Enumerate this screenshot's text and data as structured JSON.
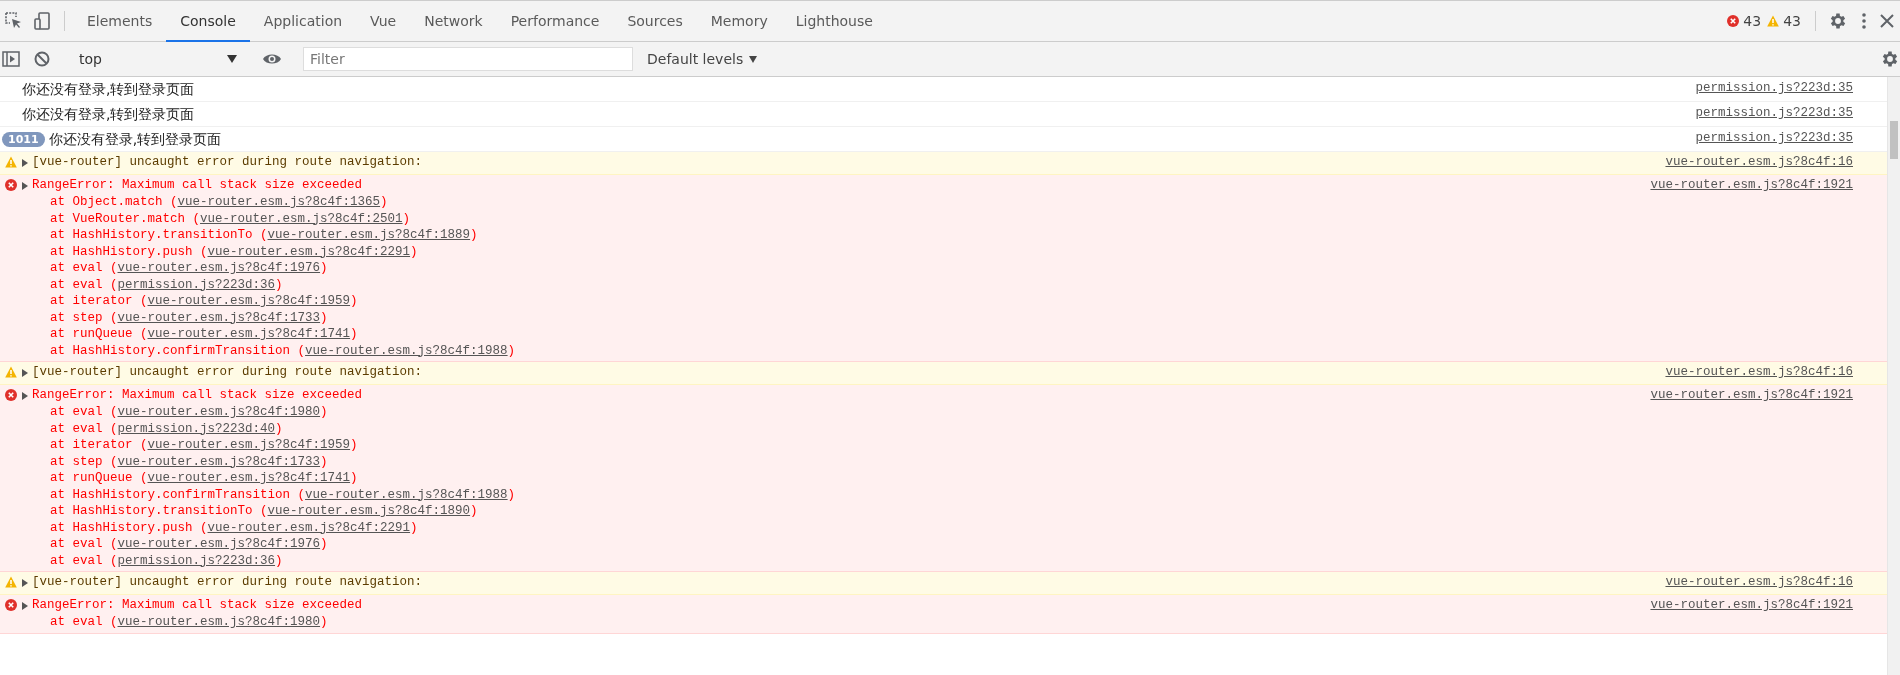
{
  "tabs": [
    {
      "label": "Elements",
      "selected": false
    },
    {
      "label": "Console",
      "selected": true
    },
    {
      "label": "Application",
      "selected": false
    },
    {
      "label": "Vue",
      "selected": false
    },
    {
      "label": "Network",
      "selected": false
    },
    {
      "label": "Performance",
      "selected": false
    },
    {
      "label": "Sources",
      "selected": false
    },
    {
      "label": "Memory",
      "selected": false
    },
    {
      "label": "Lighthouse",
      "selected": false
    }
  ],
  "counts": {
    "errors": "43",
    "warnings": "43"
  },
  "console_toolbar": {
    "context": "top",
    "filter": {
      "placeholder": "Filter"
    },
    "levels": "Default levels"
  },
  "messages": [
    {
      "kind": "log",
      "text": "你还没有登录,转到登录页面",
      "source": "permission.js?223d:35"
    },
    {
      "kind": "log",
      "text": "你还没有登录,转到登录页面",
      "source": "permission.js?223d:35"
    },
    {
      "kind": "log",
      "count": "1011",
      "text": "你还没有登录,转到登录页面",
      "source": "permission.js?223d:35"
    },
    {
      "kind": "warning",
      "text": "[vue-router] uncaught error during route navigation:",
      "source": "vue-router.esm.js?8c4f:16"
    },
    {
      "kind": "error",
      "text": "RangeError: Maximum call stack size exceeded",
      "source": "vue-router.esm.js?8c4f:1921",
      "frames": [
        {
          "before": "at Object.match (",
          "link": "vue-router.esm.js?8c4f:1365",
          "after": ")"
        },
        {
          "before": "at VueRouter.match (",
          "link": "vue-router.esm.js?8c4f:2501",
          "after": ")"
        },
        {
          "before": "at HashHistory.transitionTo (",
          "link": "vue-router.esm.js?8c4f:1889",
          "after": ")"
        },
        {
          "before": "at HashHistory.push (",
          "link": "vue-router.esm.js?8c4f:2291",
          "after": ")"
        },
        {
          "before": "at eval (",
          "link": "vue-router.esm.js?8c4f:1976",
          "after": ")"
        },
        {
          "before": "at eval (",
          "link": "permission.js?223d:36",
          "after": ")"
        },
        {
          "before": "at iterator (",
          "link": "vue-router.esm.js?8c4f:1959",
          "after": ")"
        },
        {
          "before": "at step (",
          "link": "vue-router.esm.js?8c4f:1733",
          "after": ")"
        },
        {
          "before": "at runQueue (",
          "link": "vue-router.esm.js?8c4f:1741",
          "after": ")"
        },
        {
          "before": "at HashHistory.confirmTransition (",
          "link": "vue-router.esm.js?8c4f:1988",
          "after": ")"
        }
      ]
    },
    {
      "kind": "warning",
      "text": "[vue-router] uncaught error during route navigation:",
      "source": "vue-router.esm.js?8c4f:16"
    },
    {
      "kind": "error",
      "text": "RangeError: Maximum call stack size exceeded",
      "source": "vue-router.esm.js?8c4f:1921",
      "frames": [
        {
          "before": "at eval (",
          "link": "vue-router.esm.js?8c4f:1980",
          "after": ")"
        },
        {
          "before": "at eval (",
          "link": "permission.js?223d:40",
          "after": ")"
        },
        {
          "before": "at iterator (",
          "link": "vue-router.esm.js?8c4f:1959",
          "after": ")"
        },
        {
          "before": "at step (",
          "link": "vue-router.esm.js?8c4f:1733",
          "after": ")"
        },
        {
          "before": "at runQueue (",
          "link": "vue-router.esm.js?8c4f:1741",
          "after": ")"
        },
        {
          "before": "at HashHistory.confirmTransition (",
          "link": "vue-router.esm.js?8c4f:1988",
          "after": ")"
        },
        {
          "before": "at HashHistory.transitionTo (",
          "link": "vue-router.esm.js?8c4f:1890",
          "after": ")"
        },
        {
          "before": "at HashHistory.push (",
          "link": "vue-router.esm.js?8c4f:2291",
          "after": ")"
        },
        {
          "before": "at eval (",
          "link": "vue-router.esm.js?8c4f:1976",
          "after": ")"
        },
        {
          "before": "at eval (",
          "link": "permission.js?223d:36",
          "after": ")"
        }
      ]
    },
    {
      "kind": "warning",
      "text": "[vue-router] uncaught error during route navigation:",
      "source": "vue-router.esm.js?8c4f:16"
    },
    {
      "kind": "error",
      "text": "RangeError: Maximum call stack size exceeded",
      "source": "vue-router.esm.js?8c4f:1921",
      "frames": [
        {
          "before": "at eval (",
          "link": "vue-router.esm.js?8c4f:1980",
          "after": ")"
        }
      ]
    }
  ]
}
